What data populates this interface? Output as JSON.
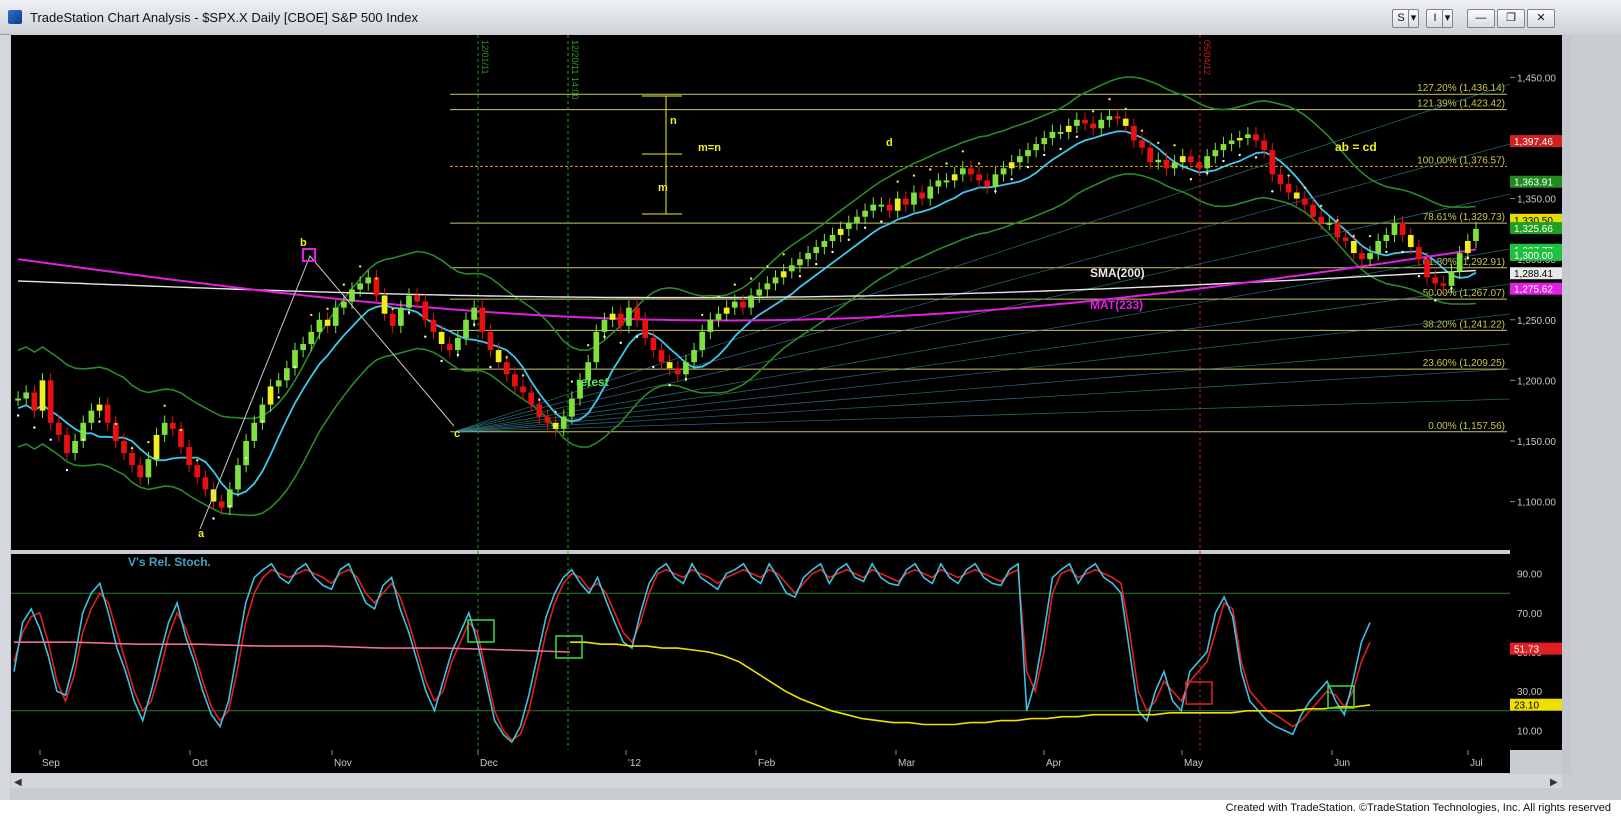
{
  "window": {
    "title": "TradeStation Chart Analysis - $SPX.X Daily [CBOE] S&P 500 Index",
    "buttons": [
      "S",
      "▾",
      "I",
      "▾",
      "—",
      "❐",
      "✕"
    ]
  },
  "footer": {
    "credit": "Created with TradeStation. ©TradeStation Technologies, Inc. All rights reserved"
  },
  "colors": {
    "background": "#000000",
    "bull": "#7fe040",
    "bear": "#e81010",
    "yellow": "#f0f020",
    "sma": "#e6e6e6",
    "mat": "#e020e0",
    "ema": "#40c8f0",
    "bands": "#2a8a2a"
  },
  "chart_data": [
    {
      "type": "candlestick",
      "title": "",
      "months": [
        "Sep",
        "Oct",
        "Nov",
        "Dec",
        "'12",
        "Feb",
        "Mar",
        "Apr",
        "May",
        "Jun",
        "Jul"
      ],
      "yticks": [
        "1,100.00",
        "1,150.00",
        "1,200.00",
        "1,250.00",
        "1,300.00",
        "1,350.00",
        "1,400.00",
        "1,450.00"
      ],
      "ylim": [
        1060,
        1485
      ],
      "close_series": [
        1185,
        1190,
        1175,
        1200,
        1165,
        1155,
        1140,
        1150,
        1165,
        1175,
        1180,
        1165,
        1150,
        1140,
        1130,
        1120,
        1135,
        1155,
        1165,
        1160,
        1145,
        1130,
        1120,
        1110,
        1100,
        1095,
        1110,
        1130,
        1150,
        1165,
        1180,
        1195,
        1200,
        1210,
        1225,
        1230,
        1240,
        1250,
        1245,
        1260,
        1265,
        1275,
        1280,
        1285,
        1270,
        1255,
        1245,
        1260,
        1270,
        1265,
        1250,
        1240,
        1230,
        1225,
        1235,
        1250,
        1260,
        1240,
        1225,
        1215,
        1205,
        1195,
        1190,
        1180,
        1170,
        1165,
        1160,
        1170,
        1185,
        1200,
        1215,
        1240,
        1250,
        1255,
        1245,
        1260,
        1250,
        1235,
        1225,
        1215,
        1210,
        1205,
        1215,
        1225,
        1240,
        1250,
        1255,
        1260,
        1265,
        1260,
        1270,
        1275,
        1280,
        1285,
        1290,
        1295,
        1300,
        1305,
        1310,
        1315,
        1320,
        1325,
        1330,
        1335,
        1340,
        1345,
        1345,
        1340,
        1350,
        1345,
        1355,
        1350,
        1360,
        1365,
        1365,
        1370,
        1375,
        1370,
        1365,
        1360,
        1370,
        1375,
        1380,
        1385,
        1390,
        1395,
        1400,
        1405,
        1405,
        1410,
        1415,
        1412,
        1408,
        1415,
        1418,
        1416,
        1410,
        1398,
        1392,
        1380,
        1382,
        1375,
        1380,
        1385,
        1380,
        1375,
        1385,
        1390,
        1395,
        1398,
        1400,
        1403,
        1398,
        1390,
        1370,
        1362,
        1355,
        1350,
        1345,
        1335,
        1330,
        1330,
        1318,
        1315,
        1305,
        1300,
        1305,
        1315,
        1320,
        1330,
        1320,
        1310,
        1300,
        1285,
        1280,
        1278,
        1290,
        1305,
        1315,
        1325
      ],
      "annotations": [
        "a",
        "b",
        "c",
        "d",
        "m",
        "n",
        "m=n",
        "ab = cd",
        "retest",
        "SMA(200)",
        "MAT(233)"
      ],
      "vlines": [
        "12/01/11",
        "12/20/11 14:00",
        "05/04/12"
      ],
      "fib_levels": [
        {
          "label": "127.20% (1,436.14)",
          "value": 1436.14
        },
        {
          "label": "121.39% (1,423.42)",
          "value": 1423.42
        },
        {
          "label": "100.00% (1,376.57)",
          "value": 1376.57
        },
        {
          "label": "78.61% (1,329.73)",
          "value": 1329.73
        },
        {
          "label": "61.80% (1,292.91)",
          "value": 1292.91
        },
        {
          "label": "50.00% (1,267.07)",
          "value": 1267.07
        },
        {
          "label": "38.20% (1,241.22)",
          "value": 1241.22
        },
        {
          "label": "23.60% (1,209.25)",
          "value": 1209.25
        },
        {
          "label": "0.00% (1,157.56)",
          "value": 1157.56
        }
      ],
      "price_tags": [
        {
          "label": "1,397.46",
          "value": 1397.46,
          "color": "#d02020"
        },
        {
          "label": "1,363.91",
          "value": 1363.91,
          "color": "#208a20"
        },
        {
          "label": "1,330.50",
          "value": 1332.5,
          "color": "#e0e000"
        },
        {
          "label": "1,325.66",
          "value": 1325.66,
          "color": "#20a020"
        },
        {
          "label": "1,307.77",
          "value": 1307.77,
          "color": "#20c040"
        },
        {
          "label": "1,300.00",
          "value": 1303.5,
          "color": "#20c040"
        },
        {
          "label": "1,288.41",
          "value": 1288.41,
          "color": "#e8e8e8"
        },
        {
          "label": "1,275.62",
          "value": 1275.62,
          "color": "#e020e0"
        }
      ]
    },
    {
      "type": "line",
      "title": "V's Rel. Stoch.",
      "yticks": [
        "10.00",
        "30.00",
        "50.00",
        "70.00",
        "90.00"
      ],
      "ylim": [
        0,
        100
      ],
      "series": [
        {
          "name": "",
          "color": "#e02020",
          "values": [
            45,
            60,
            68,
            70,
            55,
            35,
            25,
            38,
            60,
            72,
            80,
            75,
            60,
            45,
            30,
            20,
            25,
            40,
            58,
            70,
            62,
            50,
            35,
            22,
            15,
            20,
            40,
            65,
            80,
            88,
            92,
            90,
            88,
            90,
            92,
            90,
            88,
            85,
            90,
            92,
            88,
            80,
            75,
            80,
            85,
            78,
            65,
            50,
            35,
            25,
            30,
            45,
            55,
            65,
            60,
            40,
            20,
            10,
            5,
            8,
            20,
            40,
            60,
            75,
            85,
            90,
            88,
            82,
            85,
            80,
            70,
            60,
            55,
            65,
            80,
            90,
            92,
            90,
            88,
            92,
            90,
            88,
            85,
            88,
            90,
            92,
            90,
            88,
            92,
            90,
            85,
            80,
            85,
            90,
            92,
            88,
            90,
            92,
            90,
            88,
            92,
            90,
            88,
            86,
            90,
            92,
            90,
            88,
            92,
            90,
            88,
            90,
            92,
            90,
            88,
            86,
            90,
            92,
            40,
            30,
            50,
            80,
            90,
            92,
            88,
            90,
            92,
            90,
            88,
            85,
            60,
            30,
            20,
            25,
            35,
            30,
            25,
            35,
            40,
            45,
            60,
            75,
            72,
            45,
            30,
            25,
            20,
            18,
            15,
            12,
            15,
            20,
            25,
            30,
            28,
            22,
            30,
            45,
            55
          ]
        },
        {
          "name": "",
          "color": "#40c0e0",
          "values": [
            40,
            65,
            72,
            62,
            48,
            30,
            28,
            45,
            70,
            80,
            85,
            70,
            52,
            40,
            25,
            15,
            30,
            48,
            65,
            75,
            58,
            45,
            30,
            18,
            12,
            25,
            50,
            75,
            88,
            92,
            95,
            88,
            85,
            92,
            95,
            88,
            84,
            82,
            92,
            95,
            85,
            75,
            72,
            84,
            88,
            72,
            60,
            45,
            30,
            20,
            35,
            50,
            60,
            70,
            55,
            35,
            15,
            8,
            4,
            12,
            28,
            48,
            68,
            80,
            88,
            92,
            85,
            80,
            88,
            76,
            65,
            55,
            52,
            70,
            85,
            92,
            95,
            88,
            85,
            95,
            88,
            85,
            82,
            90,
            92,
            95,
            88,
            85,
            95,
            88,
            80,
            78,
            88,
            92,
            95,
            85,
            92,
            95,
            88,
            86,
            95,
            88,
            85,
            84,
            92,
            95,
            88,
            85,
            95,
            88,
            85,
            92,
            95,
            88,
            85,
            84,
            92,
            95,
            20,
            35,
            60,
            88,
            92,
            95,
            85,
            92,
            95,
            88,
            85,
            80,
            50,
            20,
            15,
            30,
            40,
            25,
            20,
            40,
            45,
            50,
            70,
            78,
            68,
            40,
            25,
            20,
            15,
            12,
            10,
            8,
            18,
            25,
            30,
            35,
            25,
            18,
            35,
            55,
            65
          ]
        },
        {
          "name": "",
          "color": "#f0e000",
          "values": [
            55,
            55,
            54,
            54,
            53,
            53,
            52,
            52,
            51,
            50,
            48,
            45,
            40,
            35,
            30,
            26,
            23,
            20,
            18,
            16,
            15,
            14,
            14,
            13,
            13,
            13,
            14,
            14,
            15,
            15,
            16,
            16,
            17,
            17,
            18,
            18,
            18,
            18,
            18,
            19,
            19,
            19,
            19,
            19,
            20,
            20,
            20,
            20,
            21,
            21,
            22,
            22,
            23
          ]
        },
        {
          "name": "",
          "color": "#f07090",
          "values": [
            55,
            55,
            54,
            54,
            53,
            53,
            52,
            52,
            51,
            50
          ]
        }
      ],
      "price_tags": [
        {
          "label": "51.73",
          "value": 51.73,
          "color": "#e02020"
        },
        {
          "label": "23.10",
          "value": 23.1,
          "color": "#f0e000"
        }
      ]
    }
  ]
}
